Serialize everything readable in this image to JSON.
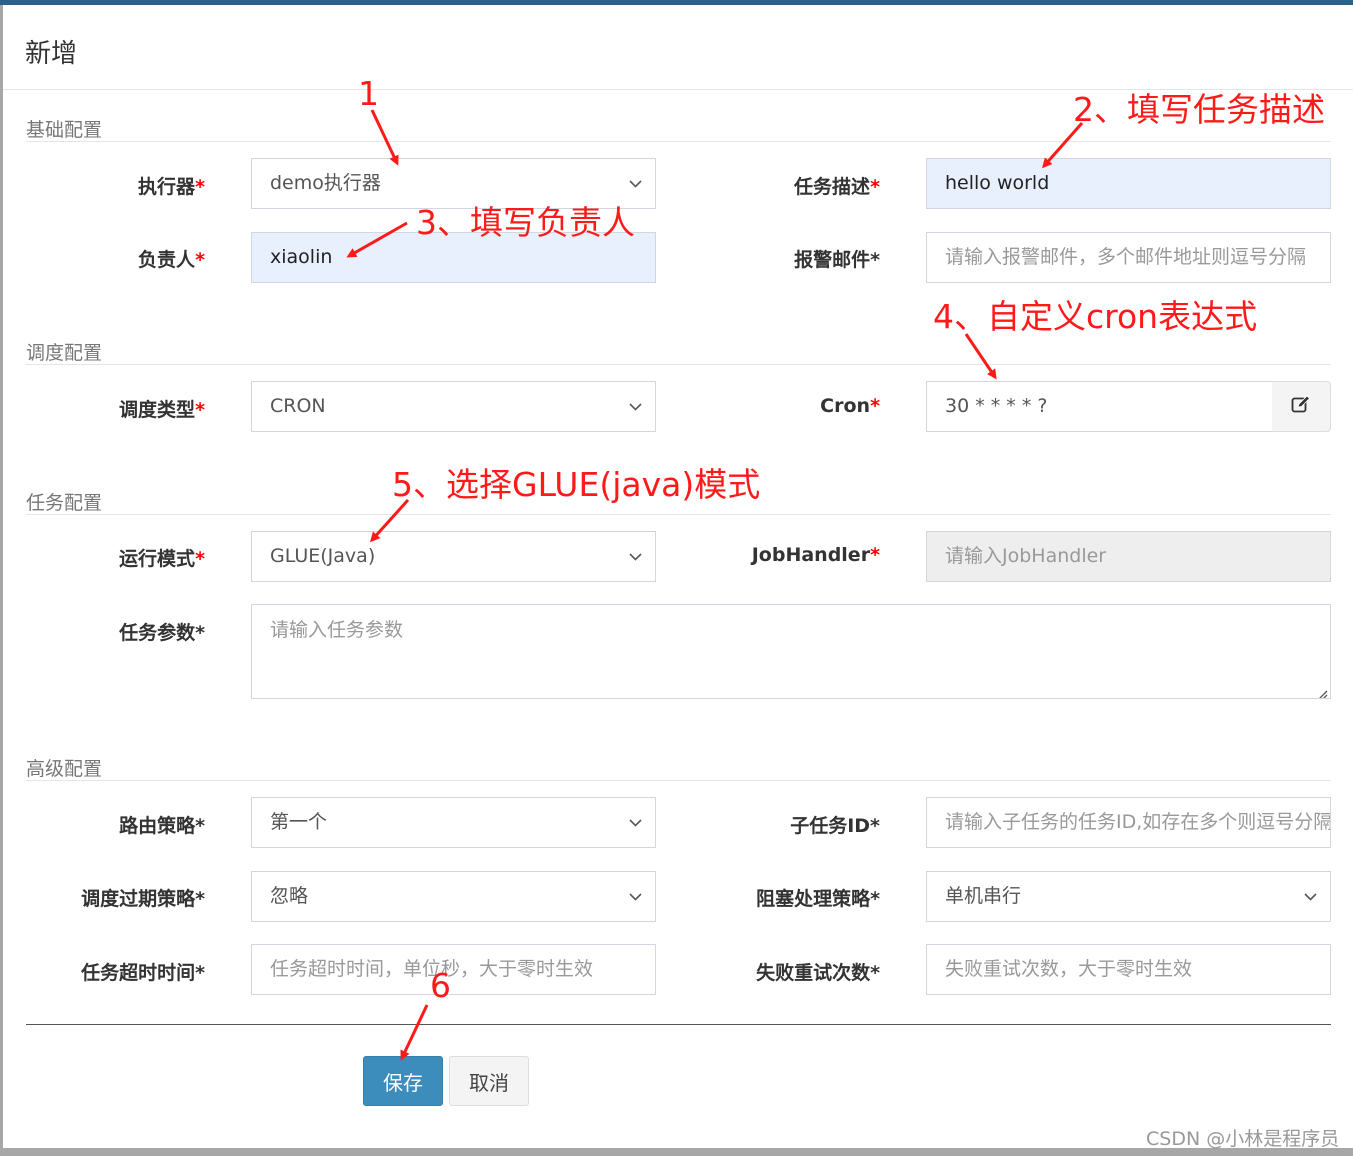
{
  "modal": {
    "title": "新增"
  },
  "sections": {
    "basic": "基础配置",
    "schedule": "调度配置",
    "task": "任务配置",
    "advanced": "高级配置"
  },
  "fields": {
    "executor": {
      "label": "执行器",
      "required_mark": "*",
      "value": "demo执行器",
      "type": "select"
    },
    "job_desc": {
      "label": "任务描述",
      "required_mark": "*",
      "value": "hello world",
      "type": "text"
    },
    "author": {
      "label": "负责人",
      "required_mark": "*",
      "value": "xiaolin",
      "type": "text"
    },
    "alarm_email": {
      "label": "报警邮件*",
      "value": "",
      "placeholder": "请输入报警邮件，多个邮件地址则逗号分隔",
      "type": "text"
    },
    "schedule_type": {
      "label": "调度类型",
      "required_mark": "*",
      "value": "CRON",
      "type": "select"
    },
    "cron": {
      "label": "Cron",
      "required_mark": "*",
      "value": "30 * * * * ?",
      "type": "text",
      "edit_icon": "edit-icon"
    },
    "glue_type": {
      "label": "运行模式",
      "required_mark": "*",
      "value": "GLUE(Java)",
      "type": "select"
    },
    "job_handler": {
      "label": "JobHandler",
      "required_mark": "*",
      "value": "",
      "placeholder": "请输入JobHandler",
      "type": "text",
      "disabled": true
    },
    "job_param": {
      "label": "任务参数*",
      "value": "",
      "placeholder": "请输入任务参数",
      "type": "textarea"
    },
    "route_strategy": {
      "label": "路由策略*",
      "value": "第一个",
      "type": "select"
    },
    "child_job_id": {
      "label": "子任务ID*",
      "value": "",
      "placeholder": "请输入子任务的任务ID,如存在多个则逗号分隔",
      "type": "text"
    },
    "misfire_strategy": {
      "label": "调度过期策略*",
      "value": "忽略",
      "type": "select"
    },
    "block_strategy": {
      "label": "阻塞处理策略*",
      "value": "单机串行",
      "type": "select"
    },
    "timeout": {
      "label": "任务超时时间*",
      "value": "",
      "placeholder": "任务超时时间，单位秒，大于零时生效",
      "type": "text"
    },
    "fail_retry": {
      "label": "失败重试次数*",
      "value": "",
      "placeholder": "失败重试次数，大于零时生效",
      "type": "text"
    }
  },
  "buttons": {
    "save": "保存",
    "cancel": "取消"
  },
  "annotations": {
    "a1": "1",
    "a2": "2、填写任务描述",
    "a3": "3、填写负责人",
    "a4": "4、自定义cron表达式",
    "a5": "5、选择GLUE(java)模式",
    "a6": "6"
  },
  "colors": {
    "accent": "#3c8dbc",
    "annotation": "#ff1a1a",
    "required": "#ff0000",
    "autofill": "#e8f0fe"
  },
  "watermark": "CSDN @小林是程序员"
}
